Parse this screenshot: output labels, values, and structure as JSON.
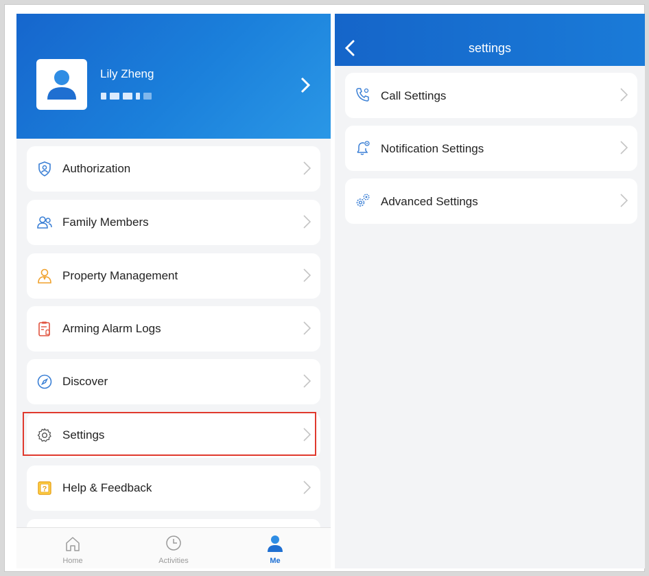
{
  "profile": {
    "name": "Lily Zheng"
  },
  "menu": {
    "items": [
      {
        "label": "Authorization",
        "icon": "shield-user-icon"
      },
      {
        "label": "Family Members",
        "icon": "family-members-icon"
      },
      {
        "label": "Property Management",
        "icon": "property-manager-icon"
      },
      {
        "label": "Arming Alarm Logs",
        "icon": "alarm-log-icon"
      },
      {
        "label": "Discover",
        "icon": "compass-icon"
      },
      {
        "label": "Settings",
        "icon": "gear-icon"
      },
      {
        "label": "Help & Feedback",
        "icon": "help-icon"
      }
    ]
  },
  "tabbar": {
    "home": "Home",
    "activities": "Activities",
    "me": "Me"
  },
  "settings_page": {
    "title": "settings",
    "items": [
      {
        "label": "Call Settings",
        "icon": "phone-gear-icon"
      },
      {
        "label": "Notification Settings",
        "icon": "bell-gear-icon"
      },
      {
        "label": "Advanced Settings",
        "icon": "gears-icon"
      }
    ]
  },
  "colors": {
    "brand_blue": "#1b78d6",
    "highlight_red": "#e0392d",
    "icon_blue": "#3a7fd5",
    "icon_orange": "#f0a12b"
  }
}
